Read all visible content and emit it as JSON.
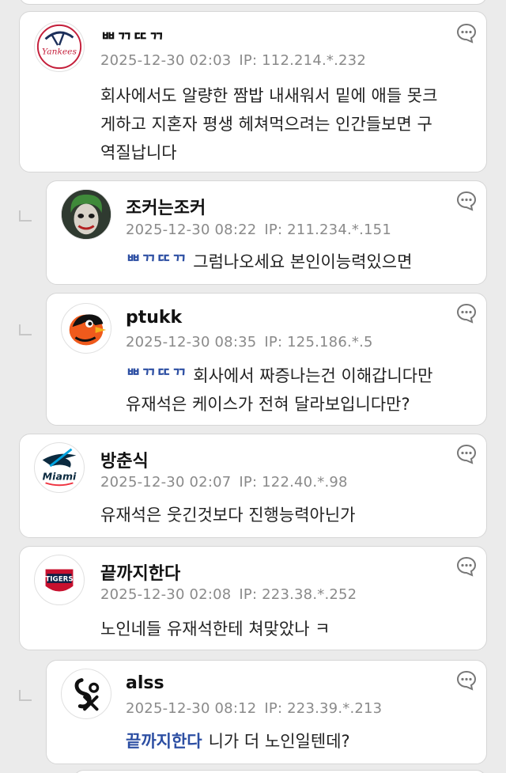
{
  "comments": [
    {
      "nick": "ᄈᄁᄄᄁ",
      "date": "2025-12-30 02:03",
      "ip": "IP: 112.214.*.232",
      "lines": [
        "회사에서도 알량한 짬밥 내새워서 밑에 애들 못크",
        "게하고 지혼자 평생 헤쳐먹으려는 인간들보면 구",
        "역질납니다"
      ],
      "avatar": "yankees-logo"
    },
    {
      "nick": "조커는조커",
      "date": "2025-12-30 08:22",
      "ip": "IP: 211.234.*.151",
      "mention": "ᄈᄁᄄᄁ",
      "lines": [
        "그럼나오세요 본인이능력있으면"
      ],
      "avatar": "joker-avatar"
    },
    {
      "nick": "ptukk",
      "date": "2025-12-30 08:35",
      "ip": "IP: 125.186.*.5",
      "mention": "ᄈᄁᄄᄁ",
      "lines": [
        "회사에서 짜증나는건 이해갑니다만",
        "유재석은 케이스가 전혀 달라보입니다만?"
      ],
      "avatar": "orioles-logo"
    },
    {
      "nick": "방춘식",
      "date": "2025-12-30 02:07",
      "ip": "IP: 122.40.*.98",
      "lines": [
        "유재석은 웃긴것보다 진행능력아닌가"
      ],
      "avatar": "marlins-logo"
    },
    {
      "nick": "끝까지한다",
      "date": "2025-12-30 02:08",
      "ip": "IP: 223.38.*.252",
      "lines": [
        "노인네들 유재석한테 쳐맞았나 ㅋ"
      ],
      "avatar": "tigers-logo"
    },
    {
      "nick": "alss",
      "date": "2025-12-30 08:12",
      "ip": "IP: 223.39.*.213",
      "mention": "끝까지한다",
      "lines": [
        "니가 더 노인일텐데?"
      ],
      "avatar": "whitesox-logo"
    }
  ],
  "avatar_texts": {
    "tigers_label": "TIGERS",
    "miami_label": "Miami",
    "yankees_label": "Yankees"
  },
  "colors": {
    "mention": "#2d4fa3",
    "meta": "#8a8a8a",
    "card_bg": "#ffffff",
    "page_bg": "#ebebeb"
  }
}
